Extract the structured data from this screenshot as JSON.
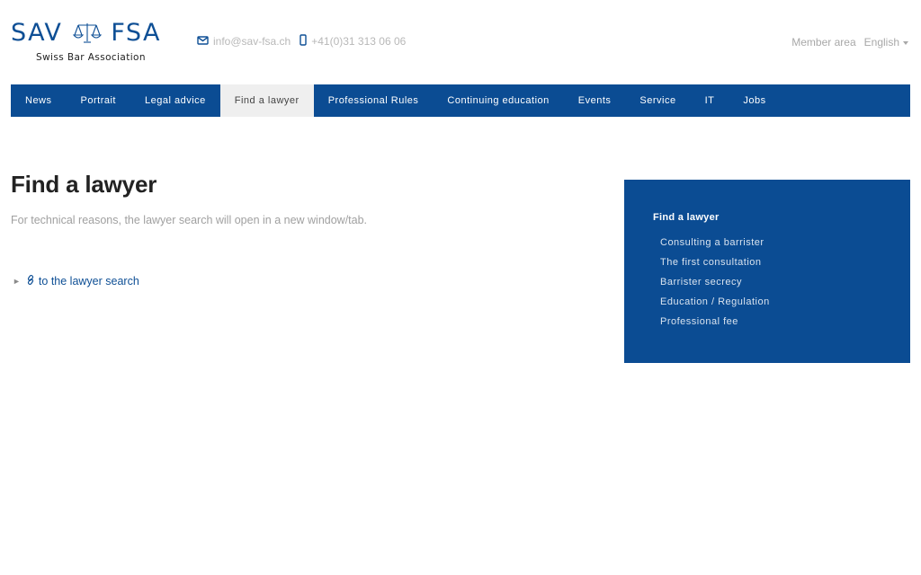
{
  "header": {
    "logo_left": "SAV",
    "logo_right": "FSA",
    "logo_subtitle": "Swiss Bar Association",
    "email": "info@sav-fsa.ch",
    "phone": "+41(0)31 313 06 06",
    "member_area": "Member area",
    "language": "English",
    "icons": {
      "logo": "scales-of-justice-icon",
      "email": "envelope-icon",
      "phone": "mobile-phone-icon",
      "language": "chevron-down-icon"
    }
  },
  "nav": {
    "items": [
      {
        "label": "News"
      },
      {
        "label": "Portrait"
      },
      {
        "label": "Legal advice"
      },
      {
        "label": "Find a lawyer",
        "active": true
      },
      {
        "label": "Professional Rules"
      },
      {
        "label": "Continuing education"
      },
      {
        "label": "Events"
      },
      {
        "label": "Service"
      },
      {
        "label": "IT"
      },
      {
        "label": "Jobs"
      }
    ]
  },
  "main": {
    "title": "Find a lawyer",
    "intro": "For technical reasons, the lawyer search will open in a new window/tab.",
    "search_link": "to the lawyer search",
    "arrow": "►"
  },
  "sidebar": {
    "title": "Find a lawyer",
    "items": [
      {
        "label": "Consulting a barrister"
      },
      {
        "label": "The first consultation"
      },
      {
        "label": "Barrister secrecy"
      },
      {
        "label": "Education / Regulation"
      },
      {
        "label": "Professional fee"
      }
    ]
  },
  "colors": {
    "brand_blue": "#0b4c93",
    "nav_active_bg": "#efefef",
    "muted_text": "#a0a0a0"
  }
}
